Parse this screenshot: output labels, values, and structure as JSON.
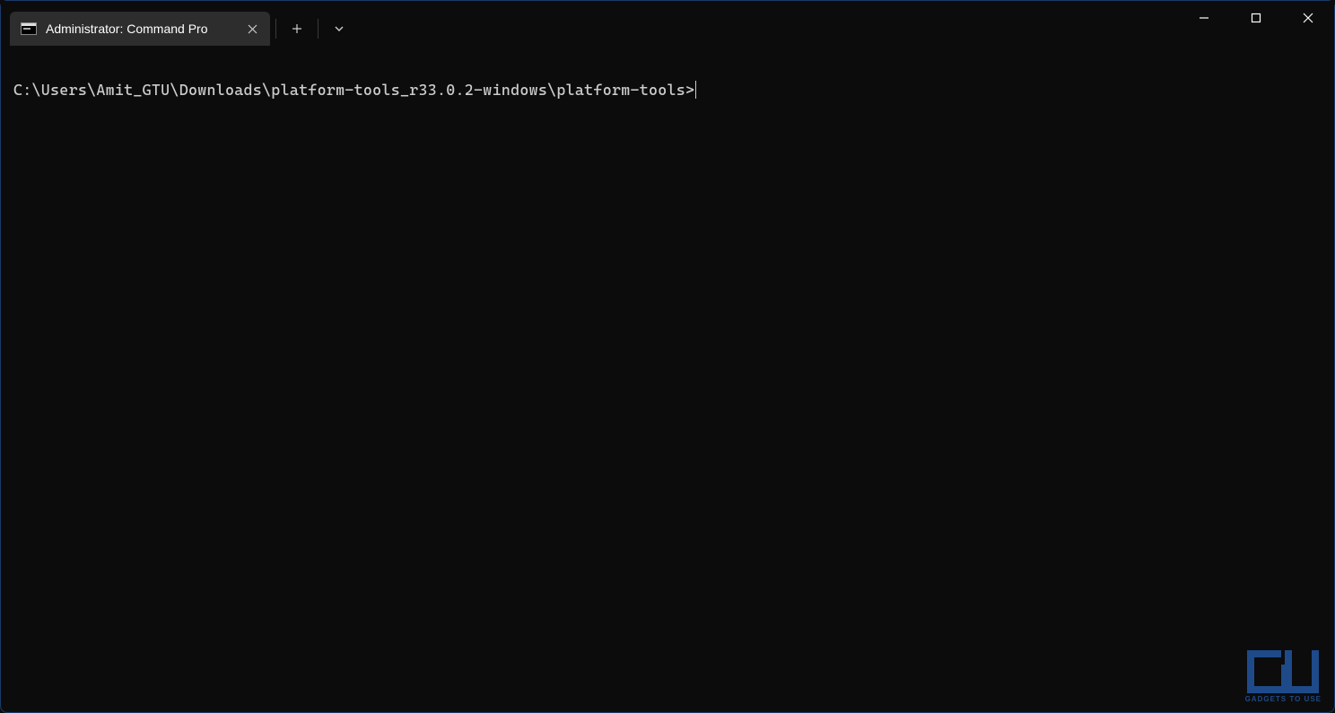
{
  "tab": {
    "title": "Administrator: Command Pro"
  },
  "terminal": {
    "prompt": "C:\\Users\\Amit_GTU\\Downloads\\platform-tools_r33.0.2-windows\\platform-tools>"
  },
  "watermark": {
    "text": "GADGETS TO USE"
  }
}
